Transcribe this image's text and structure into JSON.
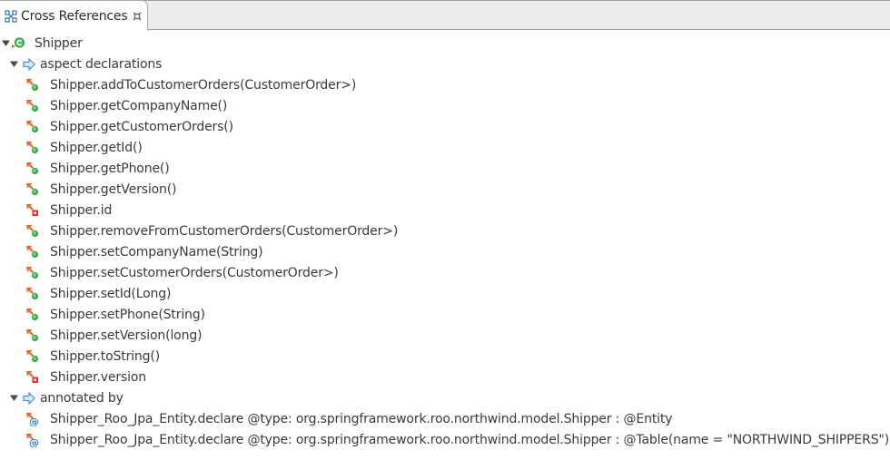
{
  "view": {
    "tab_label": "Cross References",
    "tab_icon": "cross-references-icon",
    "close_icon": "close-icon"
  },
  "tree": {
    "root": {
      "label": "Shipper",
      "icon": "aspect-class-icon",
      "expanded": true
    },
    "aspect_declarations": {
      "label": "aspect declarations",
      "icon": "relation-arrow-icon",
      "expanded": true,
      "items": [
        {
          "label": "Shipper.addToCustomerOrders(CustomerOrder>)",
          "icon": "itd-method-icon"
        },
        {
          "label": "Shipper.getCompanyName()",
          "icon": "itd-method-icon"
        },
        {
          "label": "Shipper.getCustomerOrders()",
          "icon": "itd-method-icon"
        },
        {
          "label": "Shipper.getId()",
          "icon": "itd-method-icon"
        },
        {
          "label": "Shipper.getPhone()",
          "icon": "itd-method-icon"
        },
        {
          "label": "Shipper.getVersion()",
          "icon": "itd-method-icon"
        },
        {
          "label": "Shipper.id",
          "icon": "itd-field-icon"
        },
        {
          "label": "Shipper.removeFromCustomerOrders(CustomerOrder>)",
          "icon": "itd-method-icon"
        },
        {
          "label": "Shipper.setCompanyName(String)",
          "icon": "itd-method-icon"
        },
        {
          "label": "Shipper.setCustomerOrders(CustomerOrder>)",
          "icon": "itd-method-icon"
        },
        {
          "label": "Shipper.setId(Long)",
          "icon": "itd-method-icon"
        },
        {
          "label": "Shipper.setPhone(String)",
          "icon": "itd-method-icon"
        },
        {
          "label": "Shipper.setVersion(long)",
          "icon": "itd-method-icon"
        },
        {
          "label": "Shipper.toString()",
          "icon": "itd-method-icon"
        },
        {
          "label": "Shipper.version",
          "icon": "itd-field-icon"
        }
      ]
    },
    "annotated_by": {
      "label": "annotated by",
      "icon": "relation-arrow-icon",
      "expanded": true,
      "items": [
        {
          "label": "Shipper_Roo_Jpa_Entity.declare @type: org.springframework.roo.northwind.model.Shipper : @Entity",
          "icon": "declare-annotation-icon"
        },
        {
          "label": "Shipper_Roo_Jpa_Entity.declare @type: org.springframework.roo.northwind.model.Shipper : @Table(name = \"NORTHWIND_SHIPPERS\")",
          "icon": "declare-annotation-icon"
        }
      ]
    }
  },
  "colors": {
    "tab_bar_bg": "#ececec",
    "text": "#3a3a3a",
    "itd_orange": "#e0682a",
    "method_green": "#3aa14a",
    "field_red": "#d9333a",
    "relation_blue": "#4a90d9",
    "annotation_blue": "#3b7fc4"
  }
}
